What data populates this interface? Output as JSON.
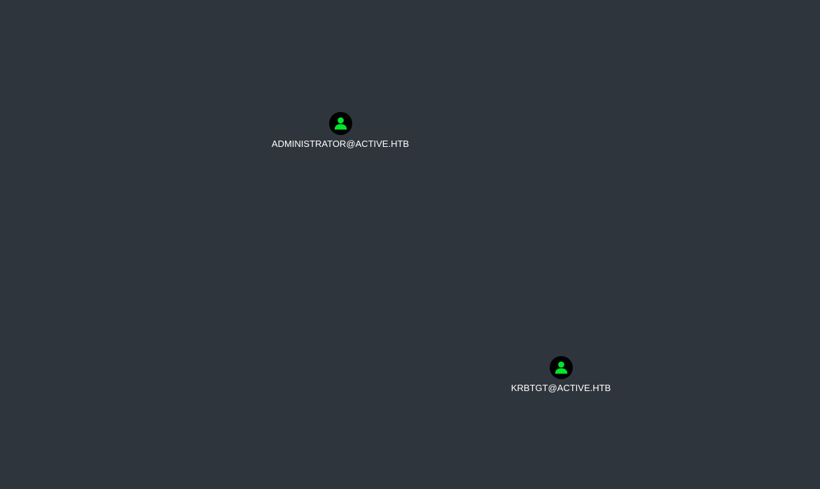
{
  "graph": {
    "background_color": "#2f353d",
    "node_icon_color": "#00e62e",
    "node_bg_color": "#000000",
    "nodes": [
      {
        "label": "ADMINISTRATOR@ACTIVE.HTB",
        "icon": "user-icon"
      },
      {
        "label": "KRBTGT@ACTIVE.HTB",
        "icon": "user-icon"
      }
    ]
  }
}
